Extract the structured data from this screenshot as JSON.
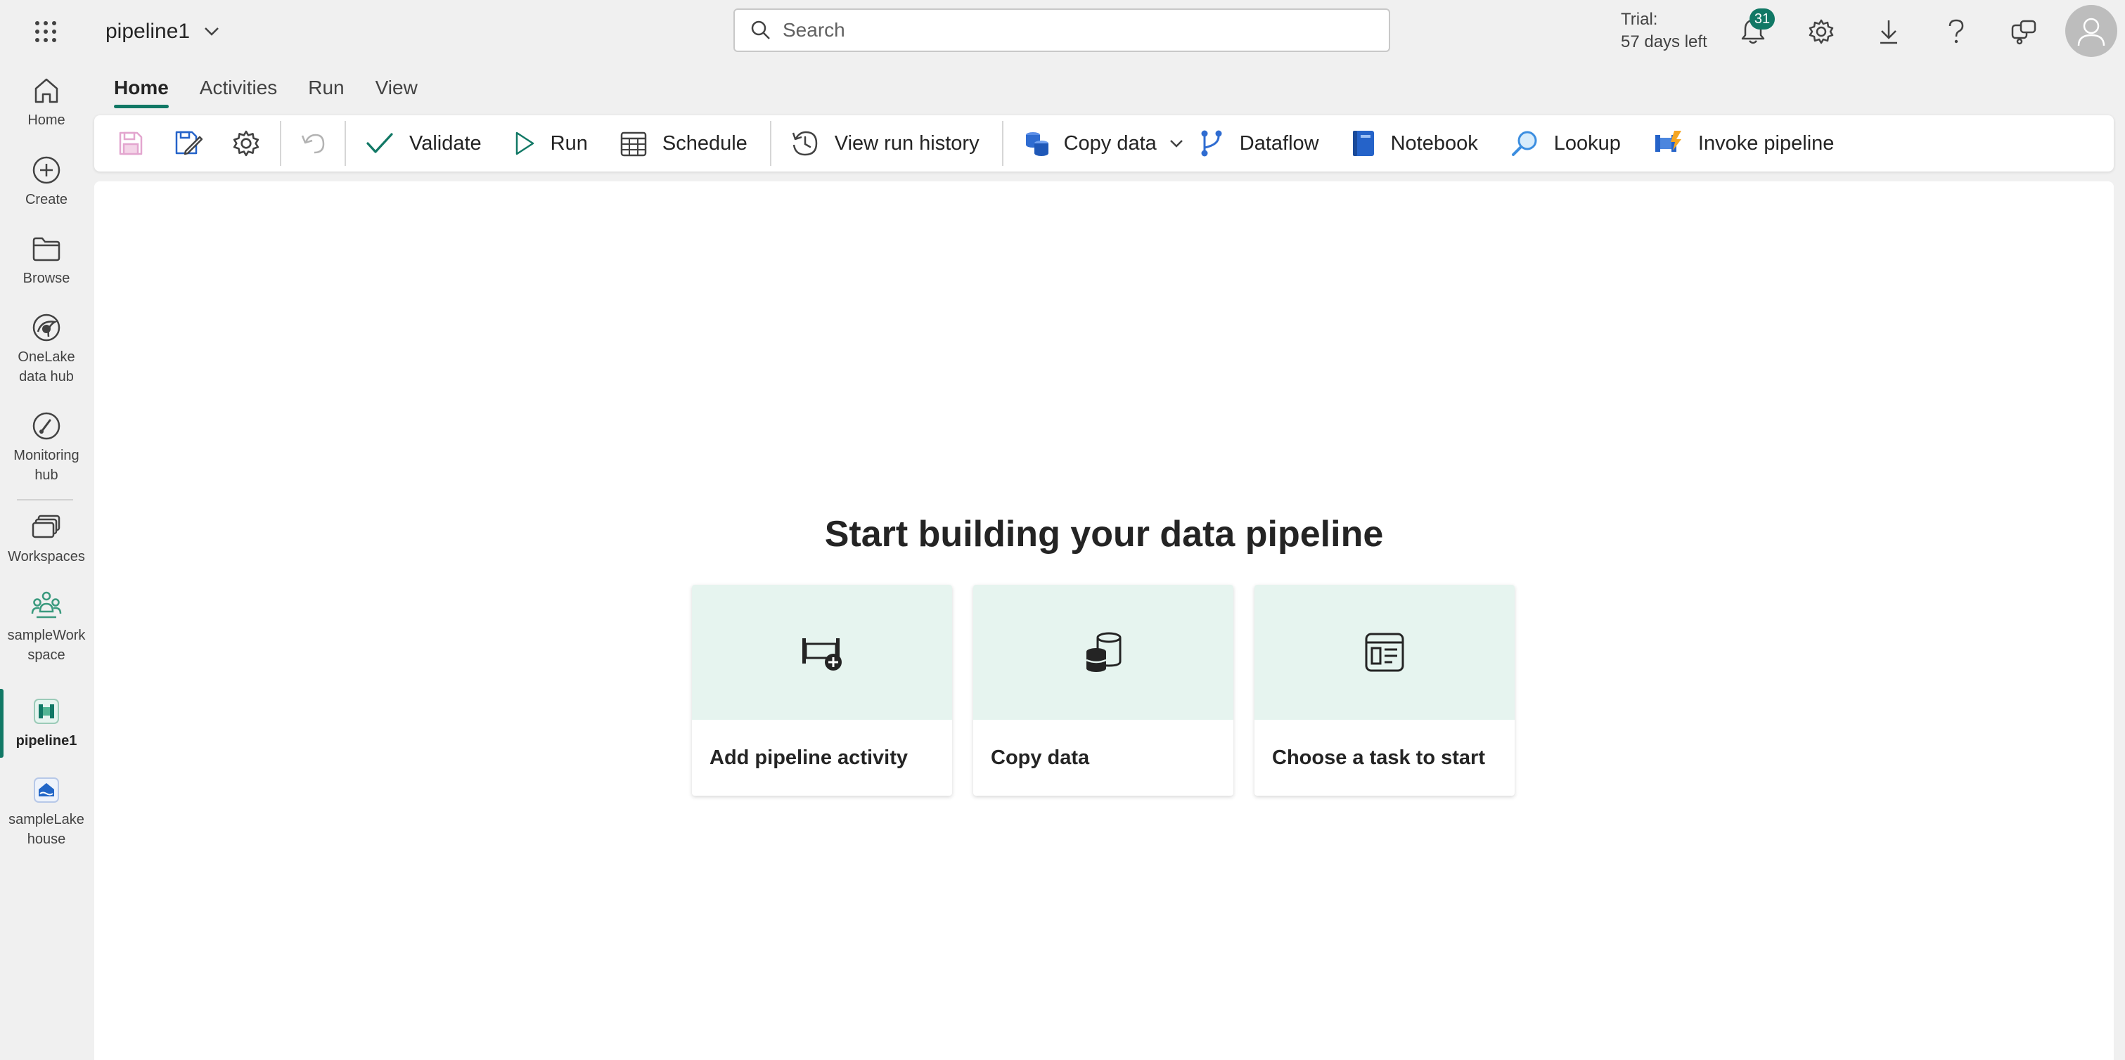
{
  "header": {
    "item_name": "pipeline1",
    "search_placeholder": "Search",
    "trial_label": "Trial:",
    "trial_days": "57 days left",
    "notification_count": "31"
  },
  "nav": {
    "items": [
      {
        "label": "Home",
        "icon": "home-icon"
      },
      {
        "label": "Create",
        "icon": "create-icon"
      },
      {
        "label": "Browse",
        "icon": "browse-icon"
      },
      {
        "label": "OneLake data hub",
        "icon": "onelake-icon"
      },
      {
        "label": "Monitoring hub",
        "icon": "monitoring-icon"
      },
      {
        "label": "Workspaces",
        "icon": "workspaces-icon"
      },
      {
        "label": "sampleWork space",
        "icon": "workspace-people-icon"
      },
      {
        "label": "pipeline1",
        "icon": "pipeline-icon"
      },
      {
        "label": "sampleLake house",
        "icon": "lakehouse-icon"
      }
    ],
    "active": "pipeline1"
  },
  "ribbon": {
    "tabs": [
      "Home",
      "Activities",
      "Run",
      "View"
    ],
    "active_tab": "Home"
  },
  "toolbar": {
    "validate": "Validate",
    "run": "Run",
    "schedule": "Schedule",
    "view_run_history": "View run history",
    "copy_data": "Copy data",
    "dataflow": "Dataflow",
    "notebook": "Notebook",
    "lookup": "Lookup",
    "invoke_pipeline": "Invoke pipeline"
  },
  "canvas": {
    "title": "Start building your data pipeline",
    "cards": [
      {
        "label": "Add pipeline activity",
        "icon": "add-activity-icon"
      },
      {
        "label": "Copy data",
        "icon": "database-icon"
      },
      {
        "label": "Choose a task to start",
        "icon": "template-icon"
      }
    ]
  },
  "colors": {
    "accent": "#117865",
    "card_header": "#e6f4ef",
    "background": "#f0f0f0"
  }
}
